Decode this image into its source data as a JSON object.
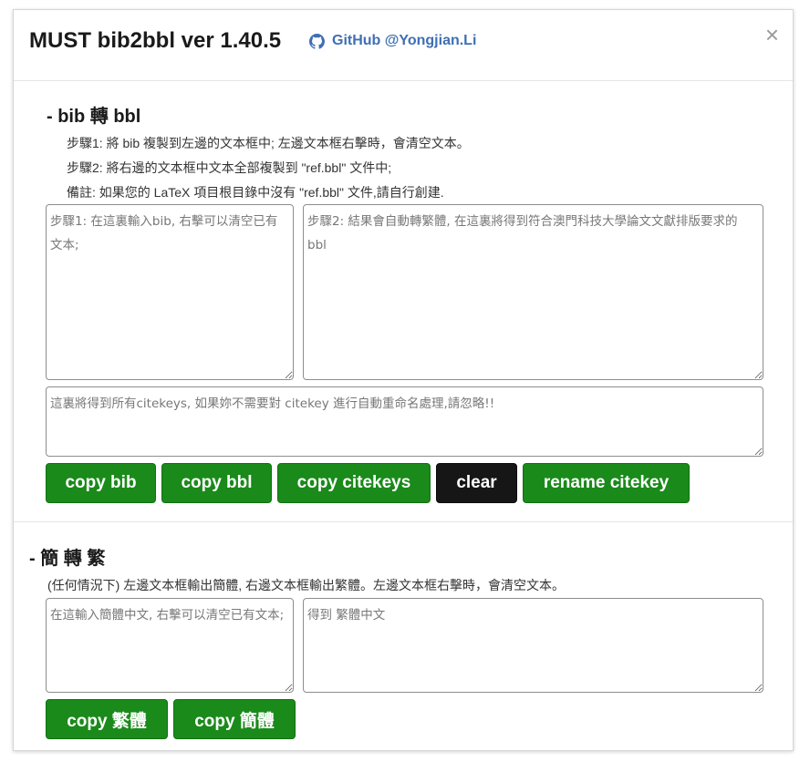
{
  "header": {
    "title": "MUST bib2bbl ver 1.40.5",
    "github_label": "GitHub @Yongjian.Li",
    "close_label": "×"
  },
  "bib_section": {
    "title": "- bib 轉 bbl",
    "step1": "步驟1: 將 bib 複製到左邊的文本框中; 左邊文本框右擊時，會清空文本。",
    "step2": "步驟2: 將右邊的文本框中文本全部複製到 \"ref.bbl\" 文件中;",
    "note": "備註: 如果您的 LaTeX 項目根目錄中沒有 \"ref.bbl\" 文件,請自行創建.",
    "bib_input_placeholder": "步驟1: 在這裏輸入bib, 右擊可以清空已有文本;",
    "bbl_output_placeholder": "步驟2: 結果會自動轉繁體, 在這裏將得到符合澳門科技大學論文文獻排版要求的 bbl",
    "citekeys_placeholder": "這裏將得到所有citekeys, 如果妳不需要對 citekey 進行自動重命名處理,請忽略!!",
    "buttons": {
      "copy_bib": "copy bib",
      "copy_bbl": "copy bbl",
      "copy_citekeys": "copy citekeys",
      "clear": "clear",
      "rename_citekey": "rename citekey"
    }
  },
  "convert_section": {
    "title": "- 簡 轉 繁",
    "description": "(任何情況下) 左邊文本框輸出簡體, 右邊文本框輸出繁體。左邊文本框右擊時，會清空文本。",
    "simplified_placeholder": "在這輸入簡體中文, 右擊可以清空已有文本;",
    "traditional_placeholder": "得到 繁體中文",
    "buttons": {
      "copy_traditional": "copy 繁體",
      "copy_simplified": "copy 簡體"
    }
  },
  "colors": {
    "button_green": "#1a8a1a",
    "button_dark": "#161616",
    "link_blue": "#3f6fb5"
  },
  "icons": {
    "github": "github-icon",
    "close": "close-icon"
  }
}
